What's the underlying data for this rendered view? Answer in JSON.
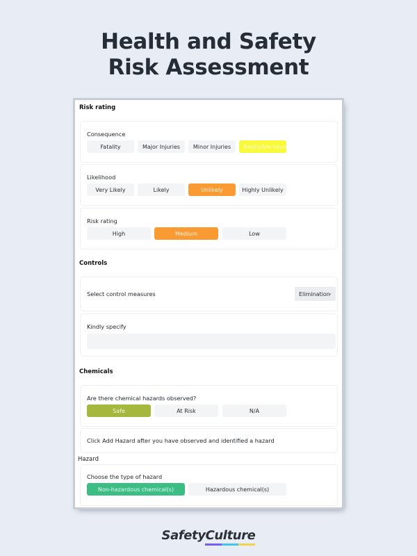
{
  "page": {
    "title_line1": "Health and Safety",
    "title_line2": "Risk Assessment"
  },
  "form": {
    "risk_rating_section": {
      "heading": "Risk rating",
      "consequence": {
        "label": "Consequence",
        "options": [
          "Fatality",
          "Major Injuries",
          "Minor Injuries",
          "Negligible Injuries"
        ],
        "selected": "Negligible Injuries"
      },
      "likelihood": {
        "label": "Likelihood",
        "options": [
          "Very Likely",
          "Likely",
          "Unlikely",
          "Highly Unlikely"
        ],
        "selected": "Unlikely"
      },
      "risk_rating": {
        "label": "Risk rating",
        "options": [
          "High",
          "Medium",
          "Low"
        ],
        "selected": "Medium"
      }
    },
    "controls_section": {
      "heading": "Controls",
      "control_measures": {
        "label": "Select control measures",
        "value": "Elimination",
        "chevron": "chevron-down-icon"
      },
      "kindly_specify": {
        "label": "Kindly specify",
        "value": ""
      }
    },
    "chemicals_section": {
      "heading": "Chemicals",
      "hazards_observed": {
        "label": "Are there chemical hazards observed?",
        "options": [
          "Safe",
          "At Risk",
          "N/A"
        ],
        "selected": "Safe"
      },
      "instruction": "Click Add Hazard after you have observed and identified a hazard",
      "hazard_label": "Hazard",
      "hazard_type": {
        "label": "Choose the type of hazard",
        "options": [
          "Non-hazardous chemical(s)",
          "Hazardous chemical(s)"
        ],
        "selected": "Non-hazardous chemical(s)"
      }
    }
  },
  "colors": {
    "yellow_selected": "#f7f93a",
    "orange_selected": "#fa9a33",
    "olive_selected": "#a5b73c",
    "green_selected": "#3bbd84",
    "brand_underline": [
      "#7b5cf0",
      "#45c3f0",
      "#f2d24a"
    ]
  },
  "brand": {
    "name": "SafetyCulture"
  }
}
